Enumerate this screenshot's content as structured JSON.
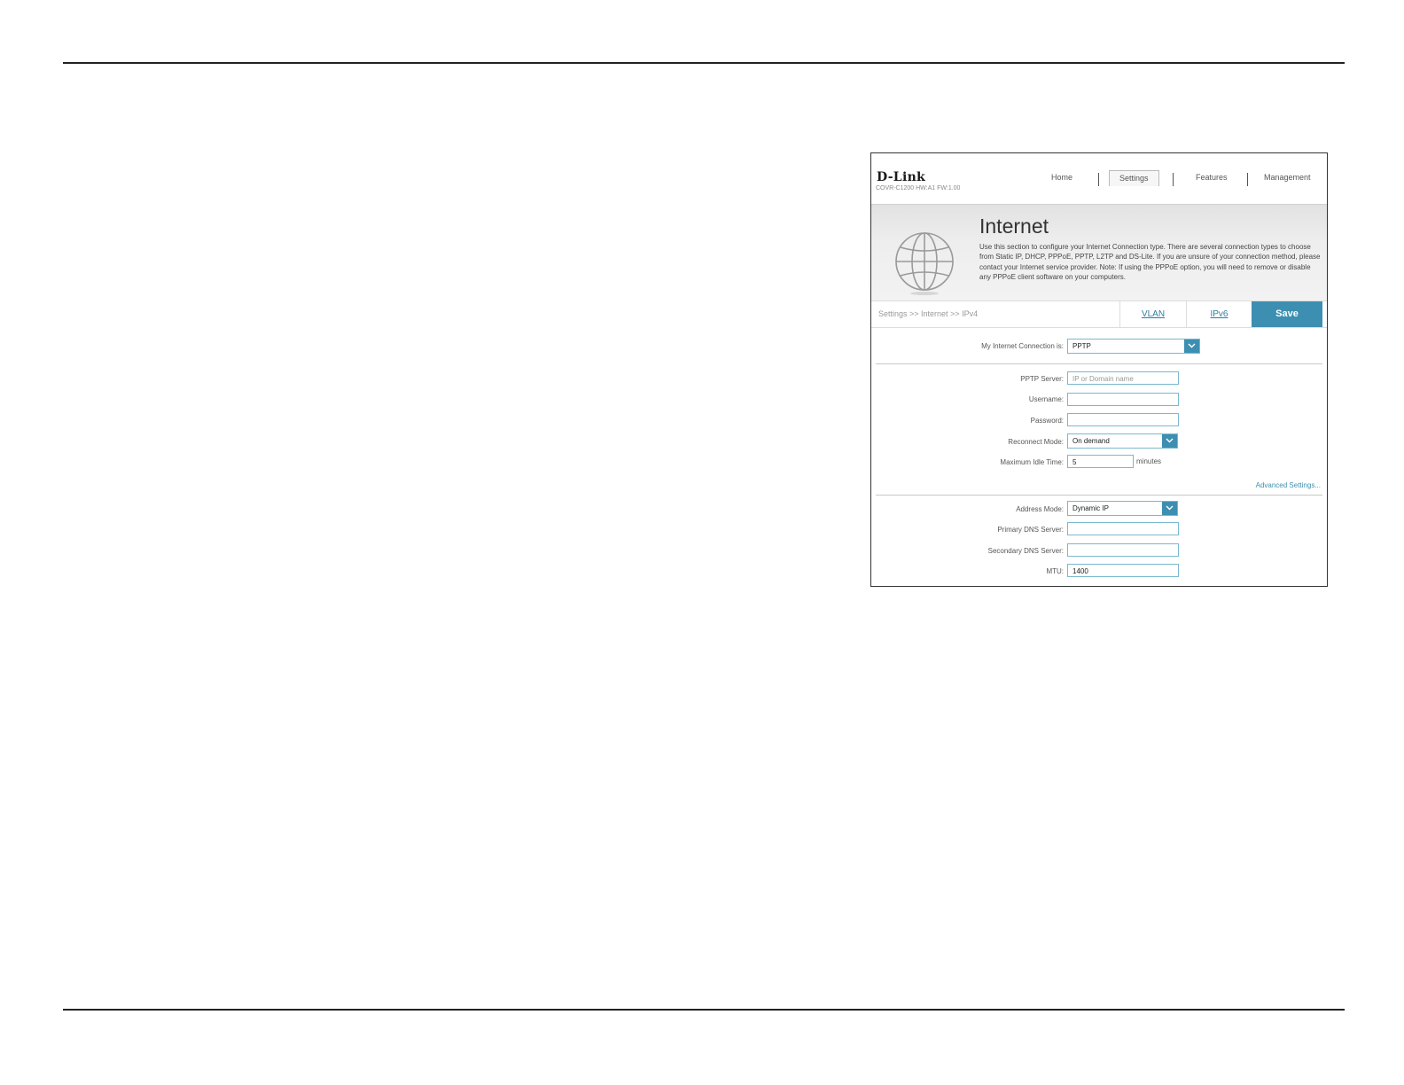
{
  "header": {
    "logo": "D-Link",
    "model": "COVR-C1200 HW:A1 FW:1.00",
    "nav": [
      "Home",
      "Settings",
      "Features",
      "Management"
    ],
    "active_nav": "Settings"
  },
  "banner": {
    "title": "Internet",
    "description": "Use this section to configure your Internet Connection type. There are several connection types to choose from Static IP, DHCP, PPPoE, PPTP, L2TP and DS-Lite. If you are unsure of your connection method, please contact your Internet service provider. Note: If using the PPPoE option, you will need to remove or disable any PPPoE client software on your computers.",
    "icon": "globe-icon"
  },
  "tabbar": {
    "breadcrumb": "Settings >> Internet >> IPv4",
    "vlan": "VLAN",
    "ipv6": "IPv6",
    "save": "Save"
  },
  "form": {
    "connection_label": "My Internet Connection is:",
    "connection_value": "PPTP",
    "pptp_server_label": "PPTP Server:",
    "pptp_server_placeholder": "IP or Domain name",
    "username_label": "Username:",
    "password_label": "Password:",
    "reconnect_label": "Reconnect Mode:",
    "reconnect_value": "On demand",
    "idle_label": "Maximum Idle Time:",
    "idle_value": "5",
    "idle_unit": "minutes",
    "advanced": "Advanced Settings...",
    "address_mode_label": "Address Mode:",
    "address_mode_value": "Dynamic IP",
    "primary_dns_label": "Primary DNS Server:",
    "secondary_dns_label": "Secondary DNS Server:",
    "mtu_label": "MTU:",
    "mtu_value": "1400"
  },
  "colors": {
    "accent": "#3c8fb1",
    "input_border": "#7ab8cf"
  }
}
